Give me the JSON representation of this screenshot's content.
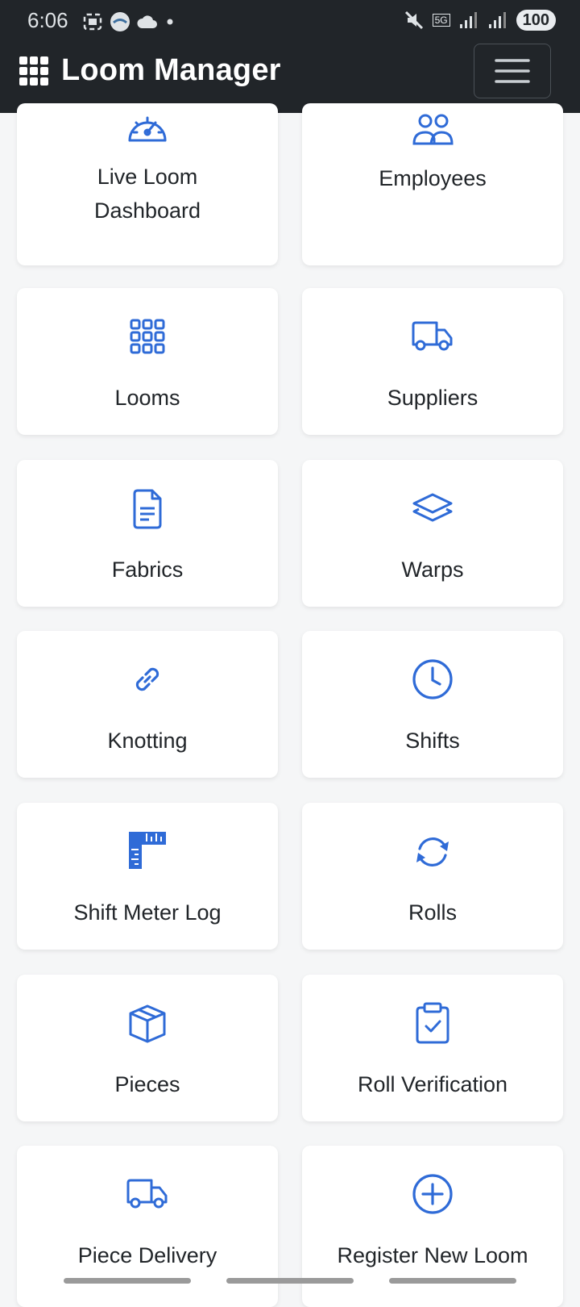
{
  "status": {
    "time": "6:06",
    "network": "5G",
    "battery": "100"
  },
  "navbar": {
    "title": "Loom Manager"
  },
  "accent": "#2f6bd7",
  "menu": [
    {
      "label": "Live Loom Dashboard",
      "icon": "speedometer-icon"
    },
    {
      "label": "Employees",
      "icon": "people-icon"
    },
    {
      "label": "Looms",
      "icon": "grid-icon"
    },
    {
      "label": "Suppliers",
      "icon": "truck-icon"
    },
    {
      "label": "Fabrics",
      "icon": "document-icon"
    },
    {
      "label": "Warps",
      "icon": "layers-icon"
    },
    {
      "label": "Knotting",
      "icon": "link-icon"
    },
    {
      "label": "Shifts",
      "icon": "clock-icon"
    },
    {
      "label": "Shift Meter Log",
      "icon": "ruler-icon"
    },
    {
      "label": "Rolls",
      "icon": "refresh-icon"
    },
    {
      "label": "Pieces",
      "icon": "box-icon"
    },
    {
      "label": "Roll Verification",
      "icon": "clipboard-check-icon"
    },
    {
      "label": "Piece Delivery",
      "icon": "truck-icon"
    },
    {
      "label": "Register New Loom",
      "icon": "plus-circle-icon"
    }
  ]
}
